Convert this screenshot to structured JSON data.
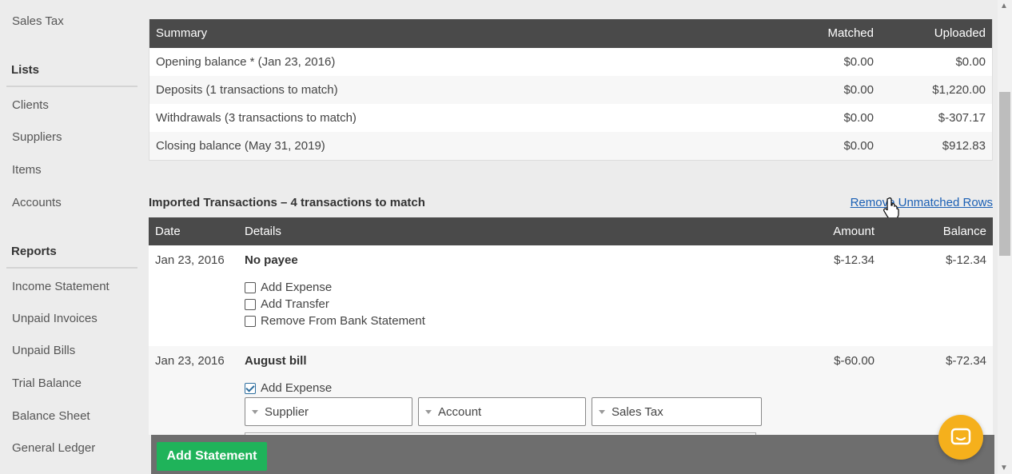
{
  "sidebar": {
    "top_item": "Sales Tax",
    "lists_heading": "Lists",
    "lists": [
      "Clients",
      "Suppliers",
      "Items",
      "Accounts"
    ],
    "reports_heading": "Reports",
    "reports": [
      "Income Statement",
      "Unpaid Invoices",
      "Unpaid Bills",
      "Trial Balance",
      "Balance Sheet",
      "General Ledger"
    ]
  },
  "summary": {
    "headers": {
      "summary": "Summary",
      "matched": "Matched",
      "uploaded": "Uploaded"
    },
    "rows": [
      {
        "label": "Opening balance * (Jan 23, 2016)",
        "matched": "$0.00",
        "uploaded": "$0.00"
      },
      {
        "label": "Deposits (1 transactions to match)",
        "matched": "$0.00",
        "uploaded": "$1,220.00"
      },
      {
        "label": "Withdrawals (3 transactions to match)",
        "matched": "$0.00",
        "uploaded": "$-307.17"
      },
      {
        "label": "Closing balance (May 31, 2019)",
        "matched": "$0.00",
        "uploaded": "$912.83"
      }
    ]
  },
  "imported": {
    "title": "Imported Transactions – 4 transactions to match",
    "remove_link": "Remove Unmatched Rows",
    "headers": {
      "date": "Date",
      "details": "Details",
      "amount": "Amount",
      "balance": "Balance"
    },
    "transactions": [
      {
        "date": "Jan 23, 2016",
        "payee": "No payee",
        "amount": "$-12.34",
        "balance": "$-12.34",
        "options": [
          {
            "label": "Add Expense",
            "checked": false
          },
          {
            "label": "Add Transfer",
            "checked": false
          },
          {
            "label": "Remove From Bank Statement",
            "checked": false
          }
        ]
      },
      {
        "date": "Jan 23, 2016",
        "payee": "August bill",
        "amount": "$-60.00",
        "balance": "$-72.34",
        "options": [
          {
            "label": "Add Expense",
            "checked": true
          }
        ],
        "selects": {
          "supplier": "Supplier",
          "account": "Account",
          "sales_tax": "Sales Tax"
        }
      }
    ]
  },
  "footer": {
    "add_statement": "Add Statement"
  },
  "colors": {
    "header": "#4a4a4a",
    "accent_green": "#1fb35a",
    "link": "#1a5fb4",
    "chat": "#f5b01c"
  }
}
